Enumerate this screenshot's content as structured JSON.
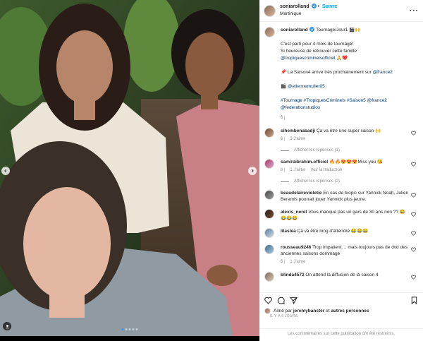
{
  "header": {
    "username": "soniarolland",
    "follow_label": "Suivre",
    "location": "Martinique"
  },
  "caption": {
    "username": "soniarolland",
    "title": "Tournage/Jour1 🎬🙌",
    "p1_line1": "C'est parti pour 4 mois de tournage!",
    "p1_line2": "Si heureuse de retrouver cette famille",
    "p1_link": "@tropiquescriminelsofficiel",
    "p1_emoji": " 🙏❤️",
    "p2_text": "📌 La Saison4 arrive très prochainement sur ",
    "p2_link": "@france2",
    "p3_prefix": "🎬 ",
    "p3_link": "@etiennemuller05",
    "p4_line1": "#Tournage #TropiquesCriminels #Saison5 @france2",
    "p4_line2": "@federationstudios",
    "age": "6 j"
  },
  "comments": [
    {
      "user": "sihembenabadji",
      "text": "Ça va être une super saison 🙌",
      "age": "6 j",
      "likes": "3 J'aime",
      "reply": "",
      "replies": "Afficher les réponses (1)"
    },
    {
      "user": "samiraibrahim.officiel",
      "text": "🔥🔥😍😍😍Miss you 😘",
      "age": "6 j",
      "likes": "1 J'aime",
      "reply": "Voir la traduction",
      "replies": "Afficher les réponses (2)"
    },
    {
      "user": "beaudelairevioletie",
      "text": "En cas de biopic sur Yannick Noah, Julien Beramis pourrait jouer Yannick plus jeune.",
      "age": "",
      "likes": "",
      "reply": "",
      "replies": ""
    },
    {
      "user": "alexis_neret",
      "text": "Vous manque pas un gars de 30 ans non ?? 😂😂😂😂",
      "age": "",
      "likes": "",
      "reply": "",
      "replies": ""
    },
    {
      "user": "lilaslea",
      "text": "Ça va être long d'attendre 😂😂😂",
      "age": "",
      "likes": "",
      "reply": "",
      "replies": ""
    },
    {
      "user": "rousseau9246",
      "text": "Trop impatient. .. mais toujours pas de dvd des anciennes saisons dommage",
      "age": "6 j",
      "likes": "1 J'aime",
      "reply": "",
      "replies": ""
    },
    {
      "user": "blinda4572",
      "text": "On attend la diffusion de la saison 4",
      "age": "",
      "likes": "",
      "reply": "",
      "replies": ""
    }
  ],
  "footer": {
    "liked_prefix": "Aimé par ",
    "liked_user": "jeremybanster",
    "liked_suffix": " et ",
    "liked_others": "autres personnes",
    "date": "IL Y A 6 JOURS",
    "closed_text": "Les commentaires sur cette publication ont été restreints."
  },
  "colors": {
    "link": "#00376b",
    "follow": "#0095f6",
    "verified": "#3897f0"
  },
  "icons": [
    "verified-icon",
    "more-icon",
    "heart-icon",
    "comment-icon",
    "share-icon",
    "save-icon",
    "chevron-left-icon",
    "chevron-right-icon",
    "user-tag-icon"
  ]
}
